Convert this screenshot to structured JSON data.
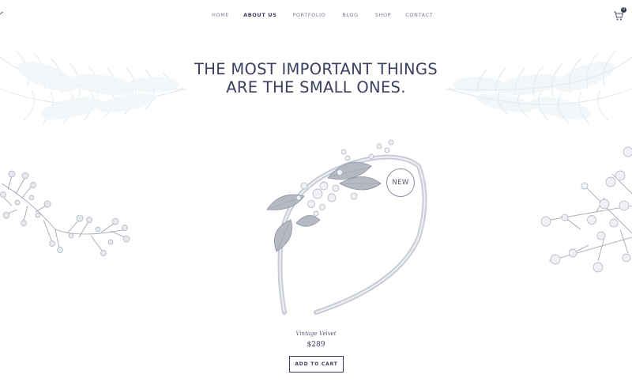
{
  "nav": {
    "items": [
      {
        "label": "HOME",
        "active": false
      },
      {
        "label": "ABOUT US",
        "active": true
      },
      {
        "label": "PORTFOLIO",
        "active": false
      },
      {
        "label": "BLOG",
        "active": false
      },
      {
        "label": "SHOP",
        "active": false
      },
      {
        "label": "CONTACT",
        "active": false
      }
    ],
    "cart_count": "0",
    "cart_icon": "shopping-cart-icon"
  },
  "hero": {
    "line1": "THE MOST IMPORTANT THINGS",
    "line2": "ARE THE SMALL ONES."
  },
  "product": {
    "badge": "NEW",
    "name": "Vintage Velvet",
    "price": "$289",
    "button": "ADD TO CART"
  },
  "colors": {
    "text": "#3b3e5e",
    "muted": "#7b7d92",
    "leaf": "#e9eef2",
    "metal": "#b9bdc8"
  }
}
